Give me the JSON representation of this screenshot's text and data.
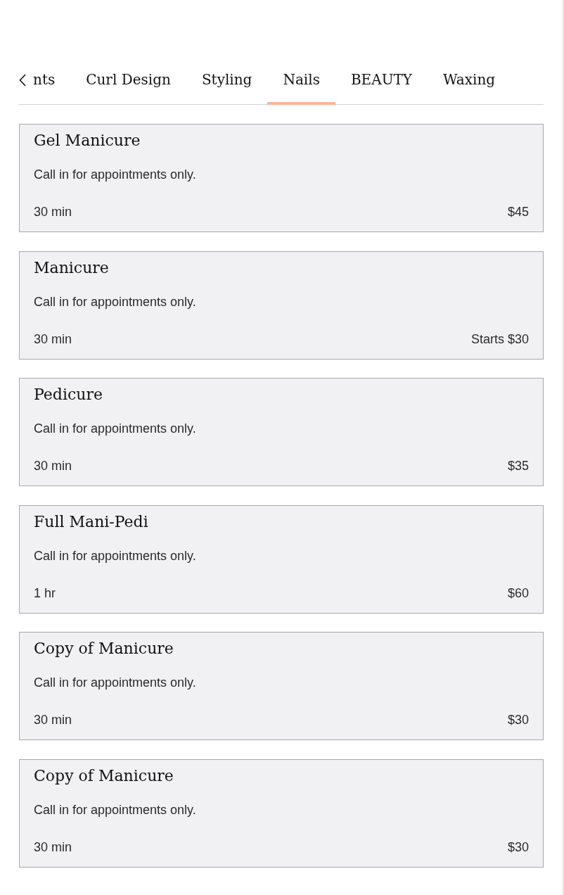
{
  "tabs": [
    {
      "label": "nts",
      "selected": false
    },
    {
      "label": "Curl Design",
      "selected": false
    },
    {
      "label": "Styling",
      "selected": false
    },
    {
      "label": "Nails",
      "selected": true
    },
    {
      "label": "BEAUTY",
      "selected": false
    },
    {
      "label": "Waxing",
      "selected": false
    }
  ],
  "services": [
    {
      "name": "Gel Manicure",
      "description": "Call in for appointments only.",
      "duration": "30 min",
      "price": "$45"
    },
    {
      "name": "Manicure",
      "description": "Call in for appointments only.",
      "duration": "30 min",
      "price": "Starts $30"
    },
    {
      "name": "Pedicure",
      "description": "Call in for appointments only.",
      "duration": "30 min",
      "price": "$35"
    },
    {
      "name": "Full Mani-Pedi",
      "description": "Call in for appointments only.",
      "duration": "1 hr",
      "price": "$60"
    },
    {
      "name": "Copy of Manicure",
      "description": "Call in for appointments only.",
      "duration": "30 min",
      "price": "$30"
    },
    {
      "name": "Copy of Manicure",
      "description": "Call in for appointments only.",
      "duration": "30 min",
      "price": "$30"
    }
  ]
}
